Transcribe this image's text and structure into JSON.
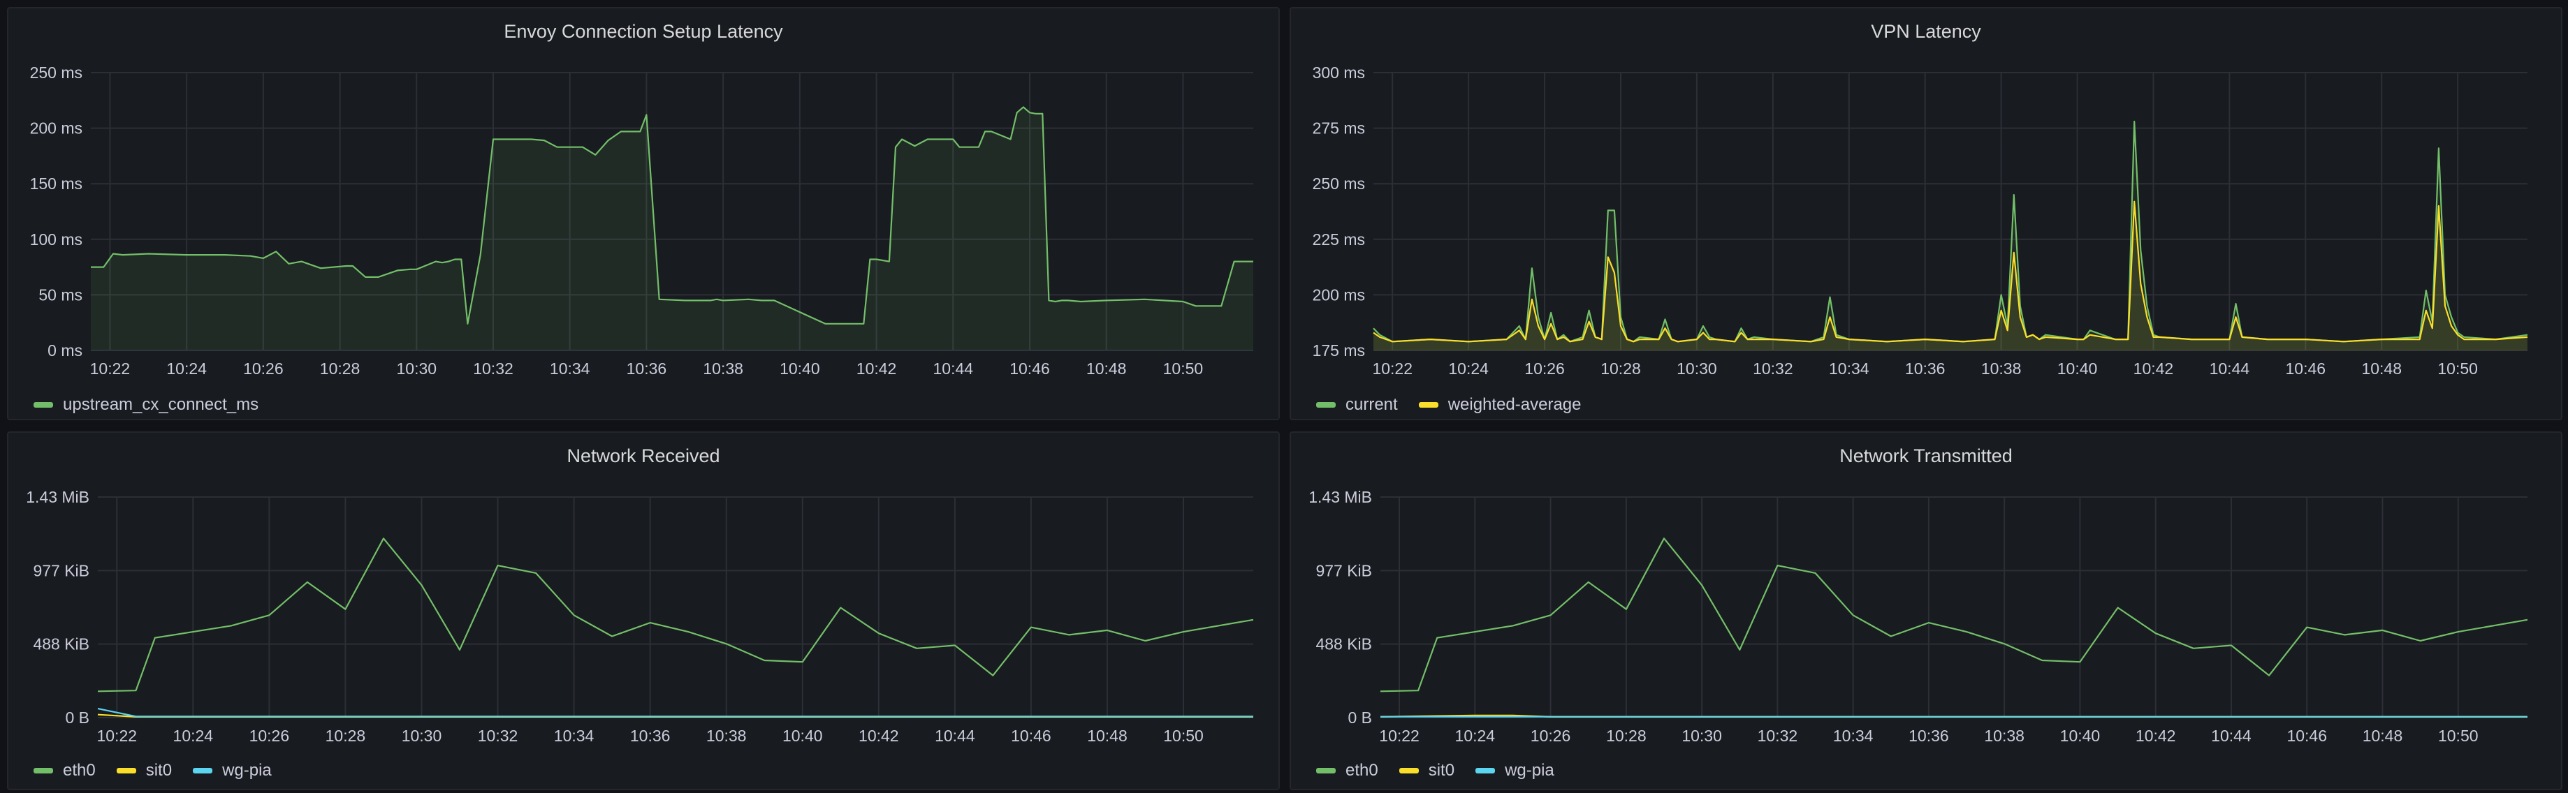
{
  "panels": [
    {
      "title": "Envoy Connection Setup Latency"
    },
    {
      "title": "VPN Latency"
    },
    {
      "title": "Network Received"
    },
    {
      "title": "Network Transmitted"
    }
  ],
  "colors": {
    "green": "#73bf69",
    "yellow": "#fade2a",
    "blue": "#8ab8ff",
    "cyan": "#5cd5f0",
    "grid": "#2c2f36",
    "text": "#ccccdc"
  },
  "chart_data": [
    {
      "type": "area",
      "title": "Envoy Connection Setup Latency",
      "xlabel": "",
      "ylabel": "",
      "x_ticks": [
        "10:22",
        "10:24",
        "10:26",
        "10:28",
        "10:30",
        "10:32",
        "10:34",
        "10:36",
        "10:38",
        "10:40",
        "10:42",
        "10:44",
        "10:46",
        "10:48",
        "10:50"
      ],
      "x_range": [
        "10:21:30",
        "10:51:50"
      ],
      "y_ticks": [
        "0 ms",
        "50 ms",
        "100 ms",
        "150 ms",
        "200 ms",
        "250 ms"
      ],
      "ylim": [
        0,
        250
      ],
      "legend_position": "bottom-left",
      "series": [
        {
          "name": "upstream_cx_connect_ms",
          "color": "#73bf69",
          "x": [
            "10:21:30",
            "10:21:50",
            "10:22:05",
            "10:22:20",
            "10:23:00",
            "10:24:00",
            "10:25:00",
            "10:25:40",
            "10:26:00",
            "10:26:10",
            "10:26:20",
            "10:26:40",
            "10:27:00",
            "10:27:30",
            "10:28:10",
            "10:28:20",
            "10:28:40",
            "10:29:00",
            "10:29:30",
            "10:29:50",
            "10:30:00",
            "10:30:30",
            "10:30:40",
            "10:30:50",
            "10:31:00",
            "10:31:10",
            "10:31:20",
            "10:31:40",
            "10:32:00",
            "10:32:20",
            "10:32:40",
            "10:33:00",
            "10:33:20",
            "10:33:40",
            "10:34:00",
            "10:34:10",
            "10:34:20",
            "10:34:40",
            "10:35:00",
            "10:35:20",
            "10:35:40",
            "10:35:50",
            "10:36:00",
            "10:36:20",
            "10:37:00",
            "10:37:40",
            "10:37:50",
            "10:38:00",
            "10:38:40",
            "10:39:00",
            "10:39:20",
            "10:40:40",
            "10:40:50",
            "10:41:00",
            "10:41:40",
            "10:41:50",
            "10:42:00",
            "10:42:20",
            "10:42:30",
            "10:42:40",
            "10:43:00",
            "10:43:20",
            "10:43:40",
            "10:44:00",
            "10:44:10",
            "10:44:40",
            "10:44:50",
            "10:45:00",
            "10:45:30",
            "10:45:40",
            "10:45:50",
            "10:46:00",
            "10:46:10",
            "10:46:20",
            "10:46:30",
            "10:46:40",
            "10:46:50",
            "10:47:00",
            "10:47:20",
            "10:48:00",
            "10:49:00",
            "10:49:30",
            "10:50:00",
            "10:50:20",
            "10:50:40",
            "10:51:00",
            "10:51:20",
            "10:51:40",
            "10:51:50"
          ],
          "values": [
            75,
            75,
            87,
            86,
            87,
            86,
            86,
            85,
            83,
            86,
            89,
            78,
            80,
            74,
            76,
            76,
            66,
            66,
            72,
            73,
            73,
            80,
            79,
            80,
            82,
            82,
            24,
            86,
            190,
            190,
            190,
            190,
            189,
            183,
            183,
            183,
            183,
            176,
            189,
            197,
            197,
            197,
            212,
            46,
            45,
            45,
            46,
            45,
            46,
            45,
            45,
            24,
            24,
            24,
            24,
            82,
            82,
            80,
            183,
            190,
            184,
            190,
            190,
            190,
            183,
            183,
            197,
            197,
            190,
            214,
            219,
            214,
            213,
            213,
            45,
            44,
            45,
            45,
            44,
            45,
            46,
            45,
            44,
            40,
            40,
            40,
            80,
            80,
            80
          ]
        }
      ]
    },
    {
      "type": "area",
      "title": "VPN Latency",
      "xlabel": "",
      "ylabel": "",
      "x_ticks": [
        "10:22",
        "10:24",
        "10:26",
        "10:28",
        "10:30",
        "10:32",
        "10:34",
        "10:36",
        "10:38",
        "10:40",
        "10:42",
        "10:44",
        "10:46",
        "10:48",
        "10:50"
      ],
      "x_range": [
        "10:21:30",
        "10:51:50"
      ],
      "y_ticks": [
        "175 ms",
        "200 ms",
        "225 ms",
        "250 ms",
        "275 ms",
        "300 ms"
      ],
      "ylim": [
        175,
        300
      ],
      "legend_position": "bottom-left",
      "series": [
        {
          "name": "current",
          "color": "#73bf69",
          "x": [
            "10:21:30",
            "10:21:40",
            "10:22:00",
            "10:23:00",
            "10:24:00",
            "10:25:00",
            "10:25:20",
            "10:25:30",
            "10:25:40",
            "10:25:50",
            "10:26:00",
            "10:26:10",
            "10:26:20",
            "10:26:30",
            "10:26:40",
            "10:27:00",
            "10:27:10",
            "10:27:20",
            "10:27:30",
            "10:27:40",
            "10:27:50",
            "10:28:00",
            "10:28:10",
            "10:28:20",
            "10:28:30",
            "10:29:00",
            "10:29:10",
            "10:29:20",
            "10:29:30",
            "10:30:00",
            "10:30:10",
            "10:30:20",
            "10:30:30",
            "10:31:00",
            "10:31:10",
            "10:31:20",
            "10:31:30",
            "10:32:00",
            "10:33:00",
            "10:33:20",
            "10:33:30",
            "10:33:40",
            "10:34:00",
            "10:35:00",
            "10:36:00",
            "10:37:00",
            "10:37:50",
            "10:38:00",
            "10:38:10",
            "10:38:20",
            "10:38:30",
            "10:38:40",
            "10:38:50",
            "10:39:00",
            "10:39:10",
            "10:40:00",
            "10:40:10",
            "10:40:20",
            "10:41:00",
            "10:41:20",
            "10:41:30",
            "10:41:40",
            "10:41:50",
            "10:42:00",
            "10:42:10",
            "10:43:00",
            "10:43:50",
            "10:44:00",
            "10:44:10",
            "10:44:20",
            "10:45:00",
            "10:46:00",
            "10:47:00",
            "10:48:00",
            "10:49:00",
            "10:49:10",
            "10:49:20",
            "10:49:30",
            "10:49:40",
            "10:49:50",
            "10:50:00",
            "10:50:10",
            "10:51:00",
            "10:51:50"
          ],
          "values": [
            185,
            182,
            179,
            180,
            179,
            180,
            186,
            180,
            212,
            190,
            180,
            192,
            180,
            182,
            179,
            181,
            193,
            181,
            180,
            238,
            238,
            190,
            180,
            179,
            181,
            180,
            189,
            180,
            179,
            180,
            186,
            181,
            180,
            179,
            185,
            180,
            181,
            180,
            179,
            181,
            199,
            182,
            180,
            179,
            180,
            179,
            180,
            200,
            186,
            245,
            195,
            181,
            182,
            180,
            182,
            180,
            180,
            184,
            180,
            180,
            278,
            220,
            195,
            182,
            181,
            180,
            180,
            180,
            196,
            181,
            180,
            180,
            179,
            180,
            181,
            202,
            188,
            266,
            200,
            190,
            183,
            181,
            180,
            182
          ]
        },
        {
          "name": "weighted-average",
          "color": "#fade2a",
          "x": [
            "10:21:30",
            "10:21:40",
            "10:22:00",
            "10:23:00",
            "10:24:00",
            "10:25:00",
            "10:25:20",
            "10:25:30",
            "10:25:40",
            "10:25:50",
            "10:26:00",
            "10:26:10",
            "10:26:20",
            "10:26:30",
            "10:26:40",
            "10:27:00",
            "10:27:10",
            "10:27:20",
            "10:27:30",
            "10:27:40",
            "10:27:50",
            "10:28:00",
            "10:28:10",
            "10:28:20",
            "10:28:30",
            "10:29:00",
            "10:29:10",
            "10:29:20",
            "10:29:30",
            "10:30:00",
            "10:30:10",
            "10:30:20",
            "10:30:30",
            "10:31:00",
            "10:31:10",
            "10:31:20",
            "10:31:30",
            "10:32:00",
            "10:33:00",
            "10:33:20",
            "10:33:30",
            "10:33:40",
            "10:34:00",
            "10:35:00",
            "10:36:00",
            "10:37:00",
            "10:37:50",
            "10:38:00",
            "10:38:10",
            "10:38:20",
            "10:38:30",
            "10:38:40",
            "10:38:50",
            "10:39:00",
            "10:39:10",
            "10:40:00",
            "10:40:10",
            "10:40:20",
            "10:41:00",
            "10:41:20",
            "10:41:30",
            "10:41:40",
            "10:41:50",
            "10:42:00",
            "10:42:10",
            "10:43:00",
            "10:43:50",
            "10:44:00",
            "10:44:10",
            "10:44:20",
            "10:45:00",
            "10:46:00",
            "10:47:00",
            "10:48:00",
            "10:49:00",
            "10:49:10",
            "10:49:20",
            "10:49:30",
            "10:49:40",
            "10:49:50",
            "10:50:00",
            "10:50:10",
            "10:51:00",
            "10:51:50"
          ],
          "values": [
            183,
            181,
            179,
            180,
            179,
            180,
            184,
            180,
            198,
            186,
            180,
            187,
            180,
            181,
            179,
            180,
            188,
            181,
            180,
            217,
            210,
            186,
            180,
            179,
            180,
            180,
            185,
            180,
            179,
            180,
            183,
            180,
            180,
            179,
            183,
            180,
            180,
            180,
            179,
            180,
            190,
            181,
            180,
            179,
            180,
            179,
            180,
            193,
            184,
            219,
            190,
            181,
            182,
            180,
            181,
            180,
            180,
            182,
            180,
            180,
            242,
            205,
            190,
            181,
            181,
            180,
            180,
            180,
            190,
            181,
            180,
            180,
            179,
            180,
            180,
            193,
            185,
            240,
            195,
            186,
            182,
            180,
            180,
            181
          ]
        }
      ]
    },
    {
      "type": "line",
      "title": "Network Received",
      "xlabel": "",
      "ylabel": "",
      "x_ticks": [
        "10:22",
        "10:24",
        "10:26",
        "10:28",
        "10:30",
        "10:32",
        "10:34",
        "10:36",
        "10:38",
        "10:40",
        "10:42",
        "10:44",
        "10:46",
        "10:48",
        "10:50"
      ],
      "x_range": [
        "10:21:30",
        "10:51:50"
      ],
      "y_ticks": [
        "0 B",
        "488 KiB",
        "977 KiB",
        "1.43 MiB"
      ],
      "ylim": [
        0,
        1465
      ],
      "legend_position": "bottom-left",
      "series": [
        {
          "name": "eth0",
          "color": "#73bf69",
          "x": [
            "10:21:30",
            "10:22:30",
            "10:23:00",
            "10:24:00",
            "10:25:00",
            "10:26:00",
            "10:27:00",
            "10:28:00",
            "10:29:00",
            "10:30:00",
            "10:31:00",
            "10:32:00",
            "10:33:00",
            "10:34:00",
            "10:35:00",
            "10:36:00",
            "10:37:00",
            "10:38:00",
            "10:39:00",
            "10:40:00",
            "10:41:00",
            "10:42:00",
            "10:43:00",
            "10:44:00",
            "10:45:00",
            "10:46:00",
            "10:47:00",
            "10:48:00",
            "10:49:00",
            "10:50:00",
            "10:51:50"
          ],
          "values": [
            175,
            180,
            530,
            570,
            610,
            680,
            900,
            720,
            1190,
            880,
            450,
            1010,
            960,
            680,
            540,
            630,
            570,
            490,
            380,
            370,
            730,
            560,
            460,
            480,
            280,
            600,
            550,
            580,
            510,
            570,
            650
          ]
        },
        {
          "name": "sit0",
          "color": "#fade2a",
          "x": [
            "10:21:30",
            "10:22:30",
            "10:51:50"
          ],
          "values": [
            20,
            5,
            5
          ]
        },
        {
          "name": "wg-pia",
          "color": "#5cd5f0",
          "x": [
            "10:21:30",
            "10:22:30",
            "10:51:50"
          ],
          "values": [
            60,
            8,
            8
          ]
        }
      ]
    },
    {
      "type": "line",
      "title": "Network Transmitted",
      "xlabel": "",
      "ylabel": "",
      "x_ticks": [
        "10:22",
        "10:24",
        "10:26",
        "10:28",
        "10:30",
        "10:32",
        "10:34",
        "10:36",
        "10:38",
        "10:40",
        "10:42",
        "10:44",
        "10:46",
        "10:48",
        "10:50"
      ],
      "x_range": [
        "10:21:30",
        "10:51:50"
      ],
      "y_ticks": [
        "0 B",
        "488 KiB",
        "977 KiB",
        "1.43 MiB"
      ],
      "ylim": [
        0,
        1465
      ],
      "legend_position": "bottom-left",
      "series": [
        {
          "name": "eth0",
          "color": "#73bf69",
          "x": [
            "10:21:30",
            "10:22:30",
            "10:23:00",
            "10:24:00",
            "10:25:00",
            "10:26:00",
            "10:27:00",
            "10:28:00",
            "10:29:00",
            "10:30:00",
            "10:31:00",
            "10:32:00",
            "10:33:00",
            "10:34:00",
            "10:35:00",
            "10:36:00",
            "10:37:00",
            "10:38:00",
            "10:39:00",
            "10:40:00",
            "10:41:00",
            "10:42:00",
            "10:43:00",
            "10:44:00",
            "10:45:00",
            "10:46:00",
            "10:47:00",
            "10:48:00",
            "10:49:00",
            "10:50:00",
            "10:51:50"
          ],
          "values": [
            175,
            180,
            530,
            570,
            610,
            680,
            900,
            720,
            1190,
            880,
            450,
            1010,
            960,
            680,
            540,
            630,
            570,
            490,
            380,
            370,
            730,
            560,
            460,
            480,
            280,
            600,
            550,
            580,
            510,
            570,
            650
          ]
        },
        {
          "name": "sit0",
          "color": "#fade2a",
          "x": [
            "10:21:30",
            "10:24:00",
            "10:25:00",
            "10:26:00",
            "10:51:50"
          ],
          "values": [
            5,
            15,
            15,
            5,
            5
          ]
        },
        {
          "name": "wg-pia",
          "color": "#5cd5f0",
          "x": [
            "10:21:30",
            "10:51:50"
          ],
          "values": [
            6,
            6
          ]
        }
      ]
    }
  ]
}
